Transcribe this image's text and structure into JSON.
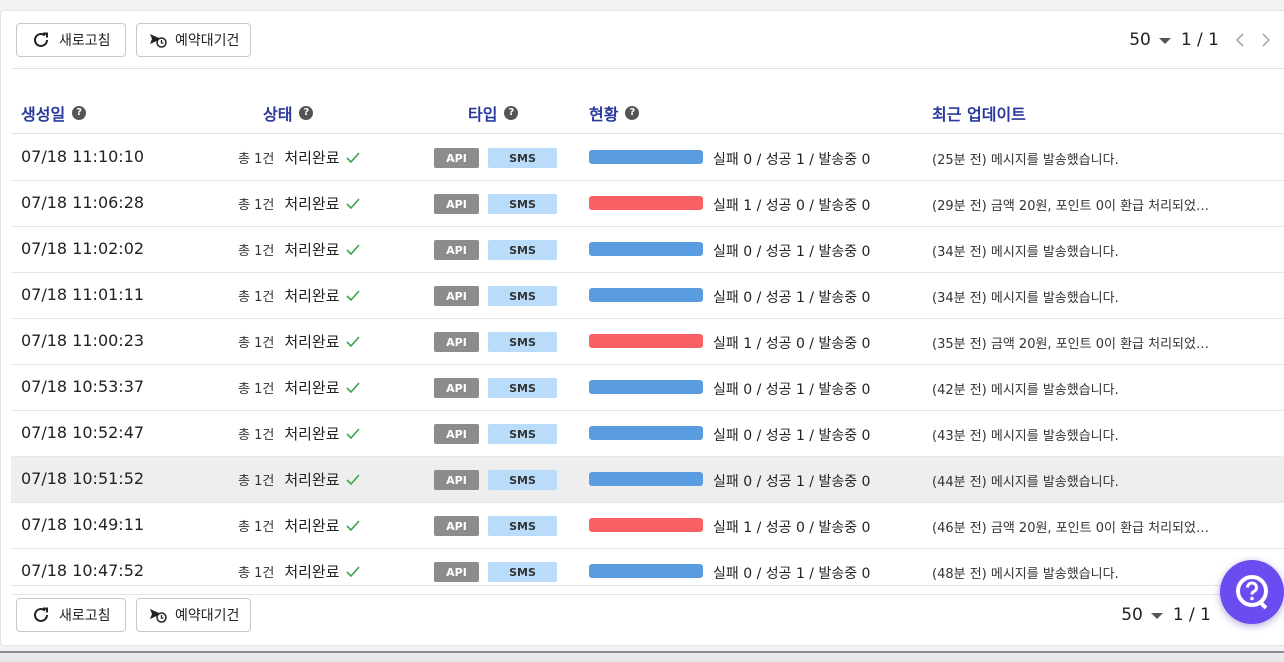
{
  "toolbar": {
    "refresh_label": "새로고침",
    "reserve_label": "예약대기건",
    "per_page": "50",
    "page_info": "1 / 1"
  },
  "table": {
    "headers": {
      "created": "생성일",
      "state": "상태",
      "type": "타입",
      "status": "현황",
      "updated": "최근 업데이트"
    },
    "rows": [
      {
        "date": "07/18 11:10:10",
        "total": "총 1건",
        "state": "처리완료",
        "api": "API",
        "sms": "SMS",
        "bar": "blue",
        "count": "실패 0 / 성공 1 / 발송중 0",
        "update": "(25분 전) 메시지를 발송했습니다."
      },
      {
        "date": "07/18 11:06:28",
        "total": "총 1건",
        "state": "처리완료",
        "api": "API",
        "sms": "SMS",
        "bar": "red",
        "count": "실패 1 / 성공 0 / 발송중 0",
        "update": "(29분 전) 금액 20원, 포인트 0이 환급 처리되었…"
      },
      {
        "date": "07/18 11:02:02",
        "total": "총 1건",
        "state": "처리완료",
        "api": "API",
        "sms": "SMS",
        "bar": "blue",
        "count": "실패 0 / 성공 1 / 발송중 0",
        "update": "(34분 전) 메시지를 발송했습니다."
      },
      {
        "date": "07/18 11:01:11",
        "total": "총 1건",
        "state": "처리완료",
        "api": "API",
        "sms": "SMS",
        "bar": "blue",
        "count": "실패 0 / 성공 1 / 발송중 0",
        "update": "(34분 전) 메시지를 발송했습니다."
      },
      {
        "date": "07/18 11:00:23",
        "total": "총 1건",
        "state": "처리완료",
        "api": "API",
        "sms": "SMS",
        "bar": "red",
        "count": "실패 1 / 성공 0 / 발송중 0",
        "update": "(35분 전) 금액 20원, 포인트 0이 환급 처리되었…"
      },
      {
        "date": "07/18 10:53:37",
        "total": "총 1건",
        "state": "처리완료",
        "api": "API",
        "sms": "SMS",
        "bar": "blue",
        "count": "실패 0 / 성공 1 / 발송중 0",
        "update": "(42분 전) 메시지를 발송했습니다."
      },
      {
        "date": "07/18 10:52:47",
        "total": "총 1건",
        "state": "처리완료",
        "api": "API",
        "sms": "SMS",
        "bar": "blue",
        "count": "실패 0 / 성공 1 / 발송중 0",
        "update": "(43분 전) 메시지를 발송했습니다."
      },
      {
        "date": "07/18 10:51:52",
        "total": "총 1건",
        "state": "처리완료",
        "api": "API",
        "sms": "SMS",
        "bar": "blue",
        "count": "실패 0 / 성공 1 / 발송중 0",
        "update": "(44분 전) 메시지를 발송했습니다."
      },
      {
        "date": "07/18 10:49:11",
        "total": "총 1건",
        "state": "처리완료",
        "api": "API",
        "sms": "SMS",
        "bar": "red",
        "count": "실패 1 / 성공 0 / 발송중 0",
        "update": "(46분 전) 금액 20원, 포인트 0이 환급 처리되었…"
      },
      {
        "date": "07/18 10:47:52",
        "total": "총 1건",
        "state": "처리완료",
        "api": "API",
        "sms": "SMS",
        "bar": "blue",
        "count": "실패 0 / 성공 1 / 발송중 0",
        "update": "(48분 전) 메시지를 발송했습니다."
      }
    ]
  },
  "colors": {
    "bar_blue": "#5b9be0",
    "bar_red": "#f96065",
    "header_text": "#2a3a9c",
    "check_green": "#3aa54a",
    "chat_bg": "#6b4cf0"
  },
  "icons": {
    "refresh": "refresh-icon",
    "reserve": "scheduled-send-icon",
    "help": "help-icon",
    "check": "check-icon",
    "chat": "chat-help-icon"
  }
}
